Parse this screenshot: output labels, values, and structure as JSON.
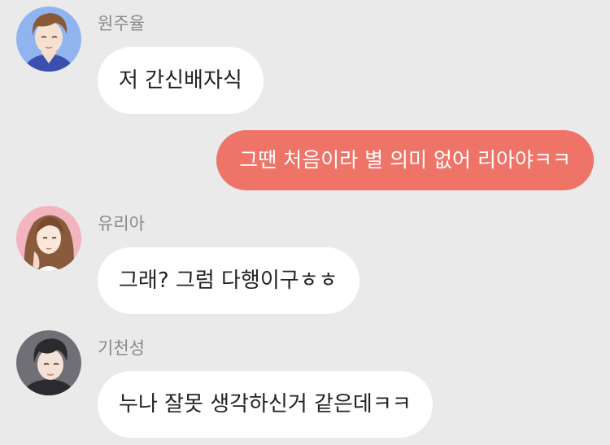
{
  "chat": {
    "messages": [
      {
        "sender": "원주율",
        "avatar_icon": "avatar-brown-hair-male-icon",
        "avatar_bg": "#8fb4f0",
        "text": "저 간신배자식"
      },
      {
        "direction": "outgoing",
        "bubble_color": "#ef7468",
        "text": "그땐 처음이라 별 의미 없어 리아야ㅋㅋ"
      },
      {
        "sender": "유리아",
        "avatar_icon": "avatar-long-hair-female-icon",
        "avatar_bg": "#f2b5c0",
        "text": "그래? 그럼 다행이구ㅎㅎ"
      },
      {
        "sender": "기천성",
        "avatar_icon": "avatar-dark-hair-male-icon",
        "avatar_bg": "#6f6f76",
        "text": "누나 잘못 생각하신거 같은데ㅋㅋ"
      }
    ]
  }
}
